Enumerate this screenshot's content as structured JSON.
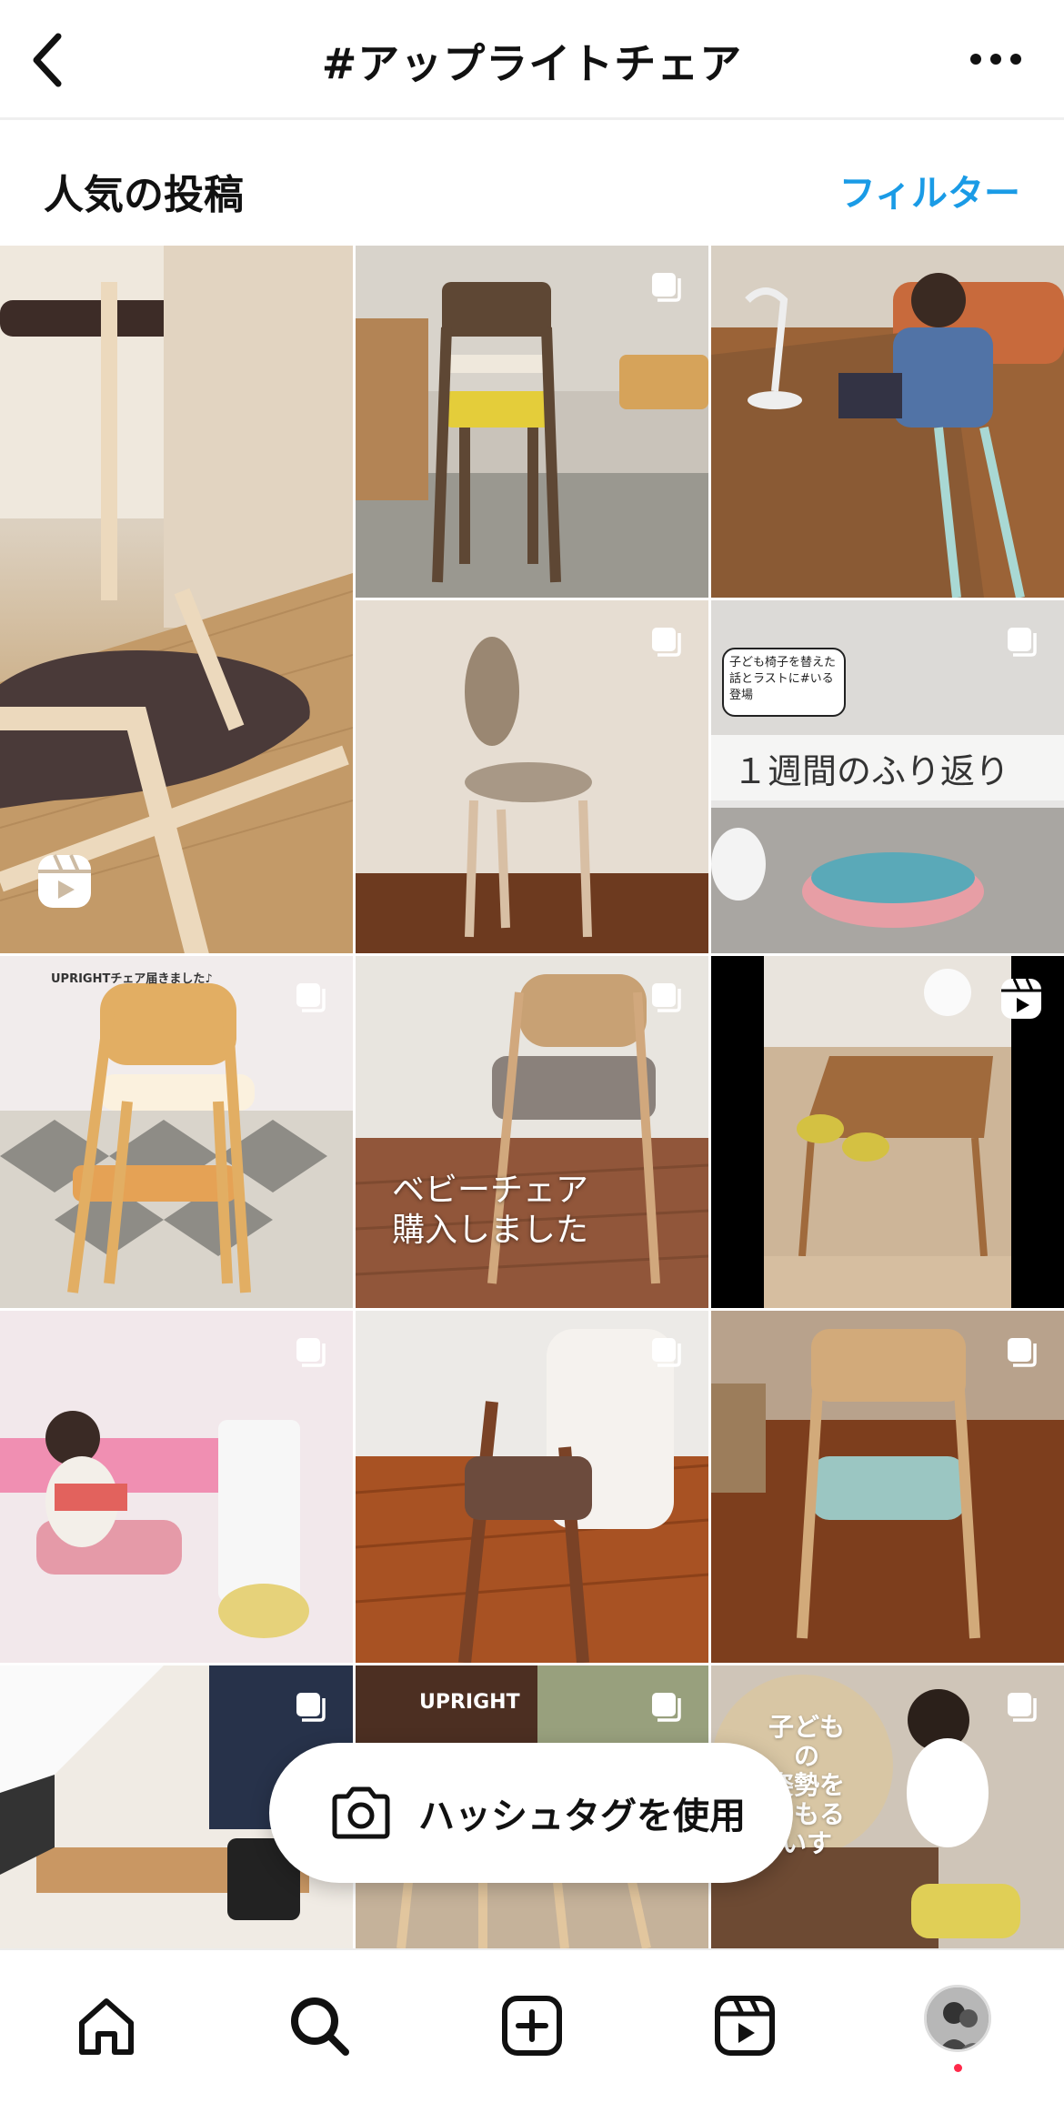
{
  "header": {
    "title": "#アップライトチェア",
    "back_icon": "chevron-left-icon",
    "more_icon": "more-horizontal-icon"
  },
  "section": {
    "title": "人気の投稿",
    "filter_label": "フィルター"
  },
  "grid": {
    "tiles": [
      {
        "kind": "reel",
        "description_icon": "reels-icon"
      },
      {
        "kind": "carousel"
      },
      {
        "kind": "image"
      },
      {
        "kind": "carousel"
      },
      {
        "kind": "carousel",
        "bubble_text": "子ども椅子を替えた話とラストに#いる登場",
        "overlay_text": "１週間のふり返り"
      },
      {
        "kind": "carousel",
        "caption_text": "UPRIGHTチェア届きました♪"
      },
      {
        "kind": "carousel",
        "overlay_text_line1": "ベビーチェア",
        "overlay_text_line2": "購入しました"
      },
      {
        "kind": "reel"
      },
      {
        "kind": "carousel"
      },
      {
        "kind": "carousel"
      },
      {
        "kind": "carousel"
      },
      {
        "kind": "carousel"
      },
      {
        "kind": "carousel",
        "sign_text": "UPRIGHT"
      },
      {
        "kind": "carousel"
      },
      {
        "kind": "carousel",
        "bubble_text_line1": "子どもの",
        "bubble_text_line2": "姿勢を",
        "bubble_text_line3": "まもる",
        "bubble_text_line4": "いす"
      }
    ]
  },
  "floating_button": {
    "label": "ハッシュタグを使用",
    "icon": "camera-icon"
  },
  "bottom_nav": {
    "items": [
      "home-icon",
      "search-icon",
      "create-icon",
      "reels-icon",
      "profile-avatar"
    ],
    "notification_color": "#ff2a4a"
  },
  "colors": {
    "accent": "#1a9be6"
  }
}
